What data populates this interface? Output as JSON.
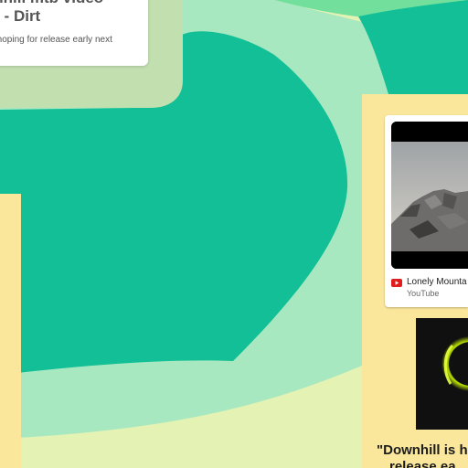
{
  "colors": {
    "teal": "#12bf96",
    "mint": "#a8e8c0",
    "light_green": "#72e09c",
    "panel_yellow": "#fbe79b",
    "background_yellow": "#e4f2b4"
  },
  "top_card": {
    "title_line1": "wnhill mtb video",
    "title_line2": "ne - Dirt",
    "description": "me hoping for release early next"
  },
  "youtube_card": {
    "icon": "youtube-icon",
    "title": "Lonely Mounta",
    "source": "YouTube"
  },
  "quote": {
    "line1": "\"Downhill is ho",
    "line2": "release ea"
  }
}
